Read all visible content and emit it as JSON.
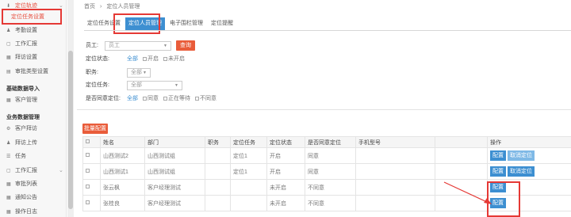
{
  "sidebar": {
    "top": "定位轨迹",
    "active": "定位任务设置",
    "items": [
      {
        "label": "考勤设置",
        "icon": "person-icon"
      },
      {
        "label": "工作汇报",
        "icon": "doc-icon"
      },
      {
        "label": "拜访设置",
        "icon": "grid-icon"
      },
      {
        "label": "审批类型设置",
        "icon": "tag-icon"
      }
    ],
    "section1": "基础数据导入",
    "section1_items": [
      {
        "label": "客户管理",
        "icon": "grid-icon"
      }
    ],
    "section2": "业务数据管理",
    "section2_items": [
      {
        "label": "客户拜访",
        "icon": "gear-icon"
      },
      {
        "label": "拜访上传",
        "icon": "person-icon"
      },
      {
        "label": "任务",
        "icon": "list-icon"
      },
      {
        "label": "工作汇报",
        "icon": "doc-icon"
      },
      {
        "label": "审批列表",
        "icon": "grid-icon"
      },
      {
        "label": "通知公告",
        "icon": "grid-icon"
      },
      {
        "label": "操作日志",
        "icon": "grid-icon"
      }
    ]
  },
  "breadcrumb": [
    "首页",
    "›",
    "定位人员管理"
  ],
  "tabs": [
    "定位任务设置",
    "定位人员管理",
    "电子围栏管理",
    "定位提醒"
  ],
  "filters": {
    "employee_label": "员工:",
    "employee_placeholder": "员工",
    "search_button": "查询",
    "status_label": "定位状态:",
    "status_options": [
      "全部",
      "开启",
      "未开启"
    ],
    "position_label": "职务:",
    "position_value": "全部",
    "task_label": "定位任务:",
    "task_value": "全部",
    "consent_label": "是否同意定位:",
    "consent_options": [
      "全部",
      "同意",
      "正在等待",
      "不同意"
    ]
  },
  "batch_button": "批量配置",
  "table": {
    "headers": [
      "",
      "姓名",
      "部门",
      "职务",
      "定位任务",
      "定位状态",
      "是否同意定位",
      "手机型号",
      "",
      "操作"
    ],
    "rows": [
      {
        "name": "山西测试2",
        "dept": "山西测试组",
        "position": "",
        "task": "定位1",
        "status": "开启",
        "consent": "同意",
        "phone": "",
        "ops": [
          "配置",
          "取消定位"
        ]
      },
      {
        "name": "山西测试1",
        "dept": "山西测试组",
        "position": "",
        "task": "定位1",
        "status": "开启",
        "consent": "同意",
        "phone": "",
        "ops": [
          "配置",
          "取消定位"
        ]
      },
      {
        "name": "张云枫",
        "dept": "客户经理测试",
        "position": "",
        "task": "",
        "status": "未开启",
        "consent": "不同意",
        "phone": "",
        "ops": [
          "配置"
        ]
      },
      {
        "name": "张桂良",
        "dept": "客户经理测试",
        "position": "",
        "task": "",
        "status": "未开启",
        "consent": "不同意",
        "phone": "",
        "ops": [
          "配置"
        ]
      }
    ]
  },
  "colors": {
    "accent": "#3d8fd1",
    "danger": "#e95c3a",
    "highlight": "#e53935"
  }
}
